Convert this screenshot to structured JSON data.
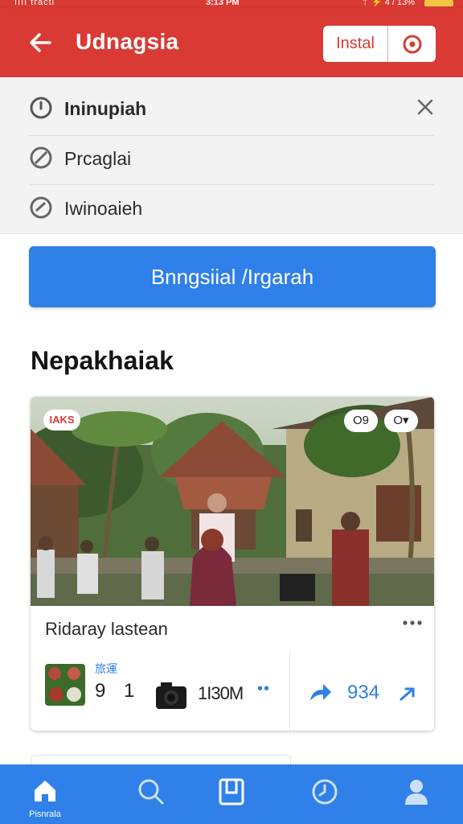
{
  "status_bar": {
    "left": "ıııı tracti",
    "time": "3:13 PM",
    "right": "⇡ ⚡ 4 / 13%"
  },
  "app_bar": {
    "title": "Udnagsia",
    "install_label": "Instal"
  },
  "menu": {
    "items": [
      {
        "label": "Ininupiah",
        "icon": "clock-icon"
      },
      {
        "label": "Prcaglai",
        "icon": "block-icon"
      },
      {
        "label": "Iwinoaieh",
        "icon": "check-circle-icon"
      }
    ]
  },
  "primary_button": {
    "label": "Bnngsiial /Irgarah"
  },
  "section": {
    "title": "Nepakhaiak"
  },
  "card": {
    "badge": "IAKS",
    "pill_left": "O9",
    "pill_right": "O▾",
    "title": "Ridaray lastean",
    "mini_label": "旅運",
    "count": "9 1",
    "size": "1I30M",
    "dots": "••",
    "share_count": "934"
  },
  "bottom_nav": {
    "items": [
      {
        "label": "Pisnrala",
        "icon": "home-icon"
      },
      {
        "label": "",
        "icon": "search-icon"
      },
      {
        "label": "",
        "icon": "bookmark-icon"
      },
      {
        "label": "",
        "icon": "clock-icon"
      },
      {
        "label": "",
        "icon": "person-icon"
      }
    ]
  },
  "colors": {
    "brand_red": "#d93a33",
    "accent_blue": "#2f80e8"
  }
}
